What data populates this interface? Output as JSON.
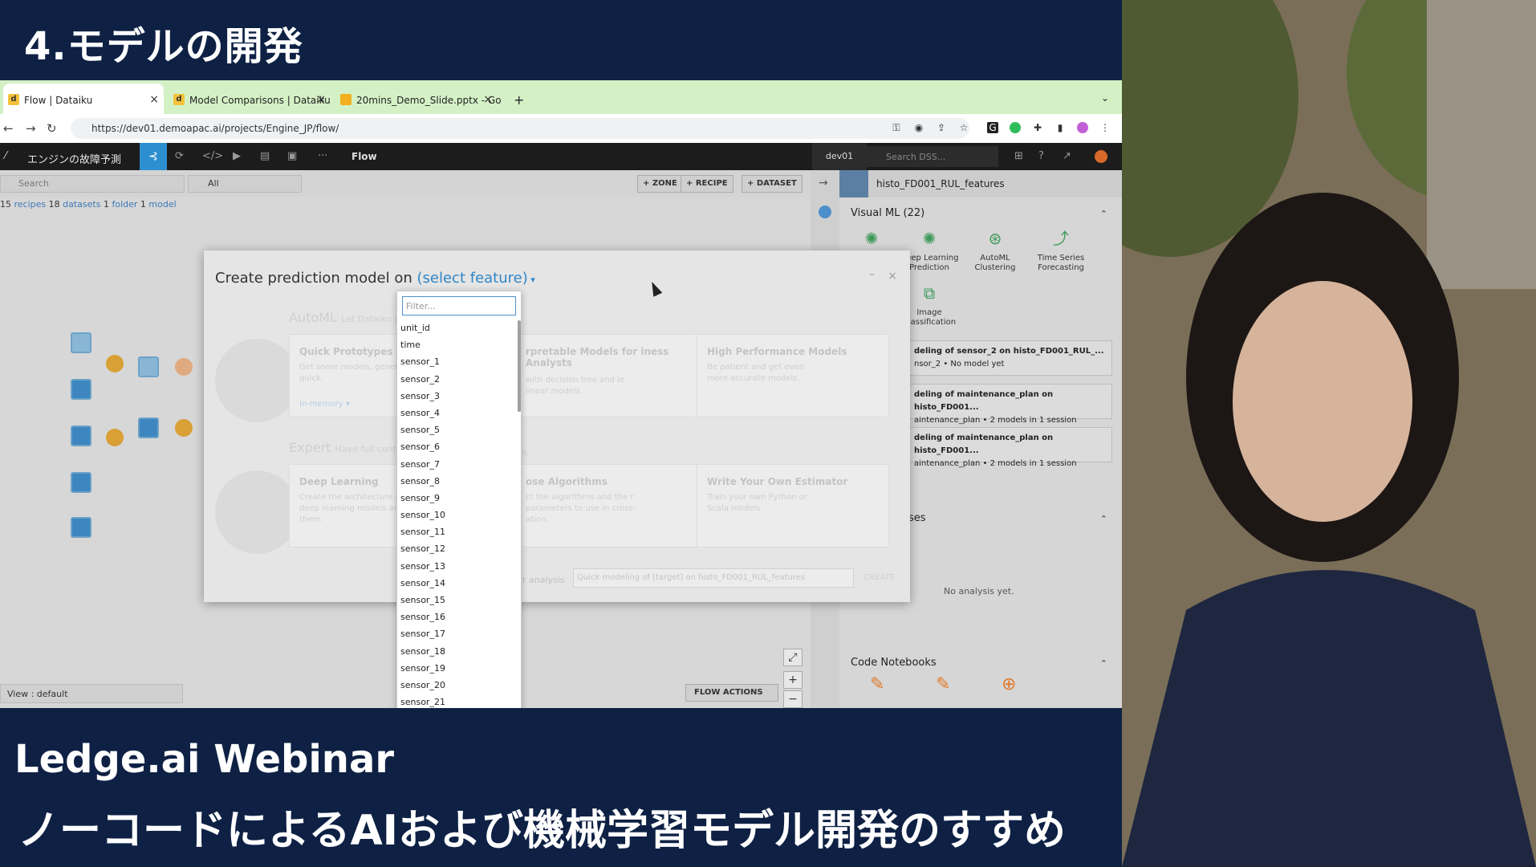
{
  "slide": {
    "title": "4.モデルの開発",
    "webinar": "Ledge.ai Webinar",
    "subtitle": "ノーコードによるAIおよび機械学習モデル開発のすすめ"
  },
  "browser": {
    "tabs": [
      {
        "label": "Flow | Dataiku",
        "icon": "d"
      },
      {
        "label": "Model Comparisons | Dataiku",
        "icon": "d"
      },
      {
        "label": "20mins_Demo_Slide.pptx - Go",
        "icon": "slides"
      }
    ],
    "url": "https://dev01.demoapac.ai/projects/Engine_JP/flow/"
  },
  "dss": {
    "project_name": "エンジンの故障予測",
    "active_view": "Flow",
    "instance": "dev01",
    "search_placeholder": "Search DSS..."
  },
  "flow": {
    "search_placeholder": "Search",
    "filter_value": "All",
    "buttons": {
      "zone": "+ ZONE",
      "recipe": "+ RECIPE",
      "dataset": "+ DATASET"
    },
    "counts": {
      "recipes_n": "15",
      "recipes": "recipes",
      "datasets_n": "18",
      "datasets": "datasets",
      "folder_n": "1",
      "folder": "folder",
      "model_n": "1",
      "model": "model"
    },
    "view_label": "View : default",
    "flow_actions": "FLOW ACTIONS"
  },
  "right_panel": {
    "dataset_name": "histo_FD001_RUL_features",
    "visual_ml_title": "Visual ML (22)",
    "ml_items": [
      {
        "label": "Deep Learning Prediction",
        "icon": "deep-learning-icon"
      },
      {
        "label": "AutoML Clustering",
        "icon": "clustering-icon"
      },
      {
        "label": "Time Series Forecasting",
        "icon": "time-series-icon"
      },
      {
        "label": "Image Classification",
        "icon": "image-classification-icon"
      }
    ],
    "cards": [
      {
        "title": "deling of sensor_2 on histo_FD001_RUL_...",
        "sub": "nsor_2 • No model yet"
      },
      {
        "title": "deling of maintenance_plan on histo_FD001...",
        "sub": "aintenance_plan • 2 models in 1 session"
      },
      {
        "title": "deling of maintenance_plan on histo_FD001...",
        "sub": "aintenance_plan • 2 models in 1 session"
      }
    ],
    "analyses_title": "ses",
    "no_analysis": "No analysis yet.",
    "notebooks_title": "Code Notebooks"
  },
  "modal": {
    "title": "Create prediction model on",
    "select_feature": "(select feature)",
    "automl_label": "AutoML",
    "automl_hint": "Let Dataiku c",
    "expert_label": "Expert",
    "expert_hint": "Have full contr",
    "expert_hint_end": "s.",
    "cards": {
      "quick_title": "Quick Prototypes",
      "quick_desc": "Get some models, generic quick.",
      "quick_link": "In-memory ▾",
      "interp_title": "rpretable Models for iness Analysts",
      "interp_desc": "with decision tree and le linear models.",
      "high_title": "High Performance Models",
      "high_desc": "Be patient and get even more accurate models.",
      "deep_title": "Deep Learning",
      "deep_desc": "Create the architecture of deep learning models and them.",
      "choose_title": "ose Algorithms",
      "choose_desc": "ct the algorithms and the r parameters to use in cross- ation.",
      "own_title": "Write Your Own Estimator",
      "own_desc": "Train your own Python or Scala models."
    },
    "analysis_label": "ur analysis",
    "analysis_value": "Quick modeling of [target] on histo_FD001_RUL_features",
    "create_label": "CREATE"
  },
  "dropdown": {
    "filter_placeholder": "Filter...",
    "options": [
      "unit_id",
      "time",
      "sensor_1",
      "sensor_2",
      "sensor_3",
      "sensor_4",
      "sensor_5",
      "sensor_6",
      "sensor_7",
      "sensor_8",
      "sensor_9",
      "sensor_10",
      "sensor_11",
      "sensor_12",
      "sensor_13",
      "sensor_14",
      "sensor_15",
      "sensor_16",
      "sensor_17",
      "sensor_18",
      "sensor_19",
      "sensor_20",
      "sensor_21"
    ]
  }
}
